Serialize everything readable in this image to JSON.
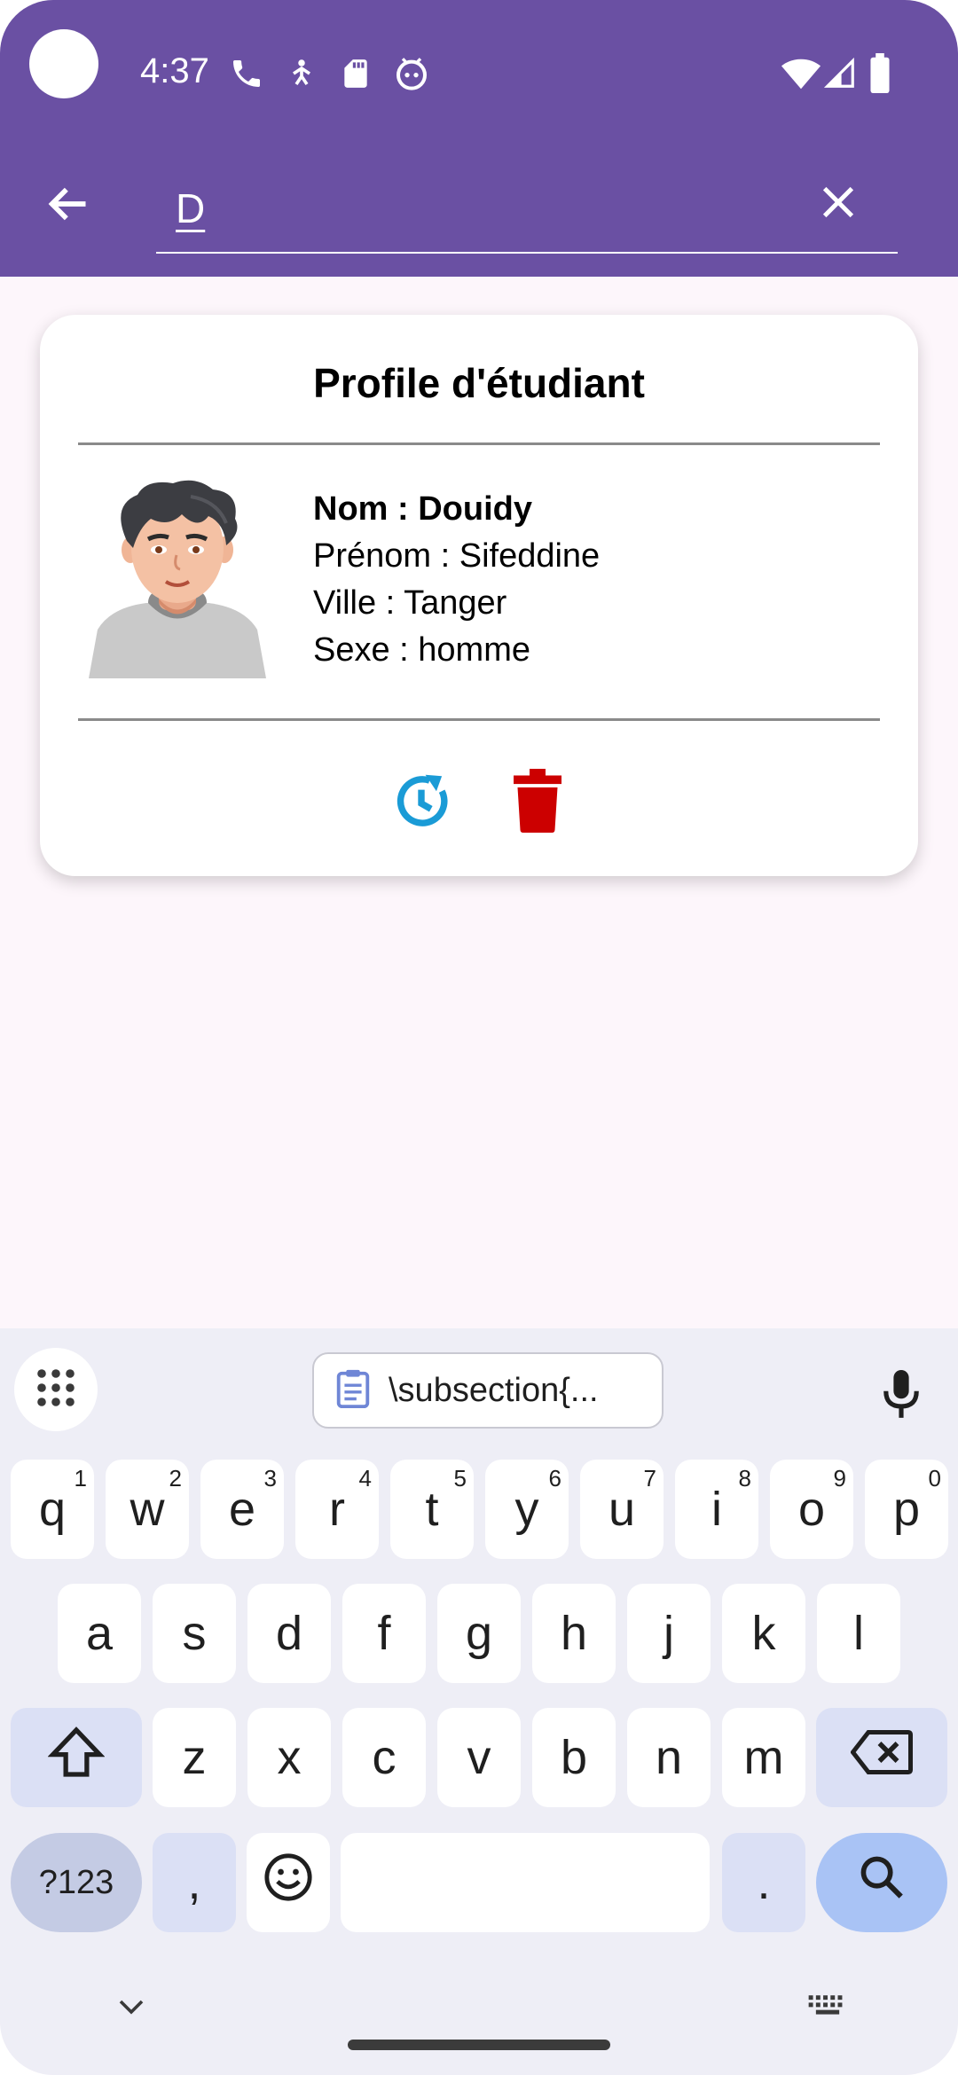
{
  "status_bar": {
    "time": "4:37",
    "icons_left": [
      "phone-icon",
      "accessibility-icon",
      "sd-card-icon",
      "android-bot-icon"
    ],
    "icons_right": [
      "wifi-icon",
      "cellular-signal-icon",
      "battery-icon"
    ]
  },
  "app_bar": {
    "back_icon": "arrow-left-icon",
    "search_value": "D",
    "clear_icon": "close-icon"
  },
  "card": {
    "title": "Profile d'étudiant",
    "nom": "Nom : Douidy",
    "prenom": "Prénom : Sifeddine",
    "ville": "Ville : Tanger",
    "sexe": "Sexe : homme",
    "actions": [
      "update-icon",
      "trash-icon"
    ],
    "colors": {
      "update": "#1a9bd6",
      "delete": "#cc0000"
    }
  },
  "keyboard": {
    "clipboard_text": "\\subsection{...",
    "row1": [
      "q",
      "w",
      "e",
      "r",
      "t",
      "y",
      "u",
      "i",
      "o",
      "p"
    ],
    "row1_hints": [
      "1",
      "2",
      "3",
      "4",
      "5",
      "6",
      "7",
      "8",
      "9",
      "0"
    ],
    "row2": [
      "a",
      "s",
      "d",
      "f",
      "g",
      "h",
      "j",
      "k",
      "l"
    ],
    "row3": [
      "z",
      "x",
      "c",
      "v",
      "b",
      "n",
      "m"
    ],
    "symbols_label": "?123",
    "comma": ",",
    "period": "."
  },
  "colors": {
    "primary": "#6a50a3",
    "background": "#fdf6fb",
    "keyboard_bg": "#eeeef6"
  }
}
